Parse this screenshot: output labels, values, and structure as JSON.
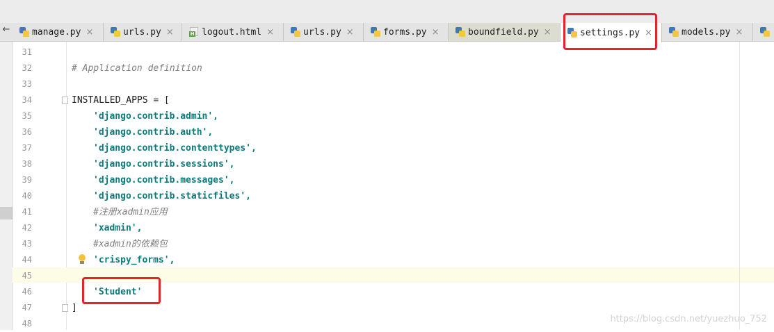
{
  "tabs": [
    {
      "label": "manage.py",
      "icon": "python-file-icon",
      "active": false
    },
    {
      "label": "urls.py",
      "icon": "python-file-icon",
      "active": false
    },
    {
      "label": "logout.html",
      "icon": "html-file-icon",
      "active": false
    },
    {
      "label": "urls.py",
      "icon": "python-file-icon",
      "active": false
    },
    {
      "label": "forms.py",
      "icon": "python-file-icon",
      "active": false
    },
    {
      "label": "boundfield.py",
      "icon": "python-file-icon",
      "active": false
    },
    {
      "label": "settings.py",
      "icon": "python-file-icon",
      "active": true
    },
    {
      "label": "models.py",
      "icon": "python-file-icon",
      "active": false
    }
  ],
  "nav_arrow": "←",
  "close_glyph": "×",
  "editor": {
    "lines": [
      {
        "num": "31",
        "text": ""
      },
      {
        "num": "32",
        "text": "# Application definition"
      },
      {
        "num": "33",
        "text": ""
      },
      {
        "num": "34",
        "text": "INSTALLED_APPS = ["
      },
      {
        "num": "35",
        "text": "'django.contrib.admin',"
      },
      {
        "num": "36",
        "text": "'django.contrib.auth',"
      },
      {
        "num": "37",
        "text": "'django.contrib.contenttypes',"
      },
      {
        "num": "38",
        "text": "'django.contrib.sessions',"
      },
      {
        "num": "39",
        "text": "'django.contrib.messages',"
      },
      {
        "num": "40",
        "text": "'django.contrib.staticfiles',"
      },
      {
        "num": "41",
        "text": "#注册xadmin应用"
      },
      {
        "num": "42",
        "text": "'xadmin',"
      },
      {
        "num": "43",
        "text": "#xadmin的依赖包"
      },
      {
        "num": "44",
        "text": "'crispy_forms',"
      },
      {
        "num": "45",
        "text": ""
      },
      {
        "num": "46",
        "text": "'Student'"
      },
      {
        "num": "47",
        "text": "]"
      },
      {
        "num": "48",
        "text": ""
      }
    ]
  },
  "watermark": "https://blog.csdn.net/yuezhuo_752",
  "colors": {
    "string": "#0a7a7a",
    "comment": "#808080",
    "highlight_box": "#e3242b",
    "caret_line": "#fdfce6"
  }
}
